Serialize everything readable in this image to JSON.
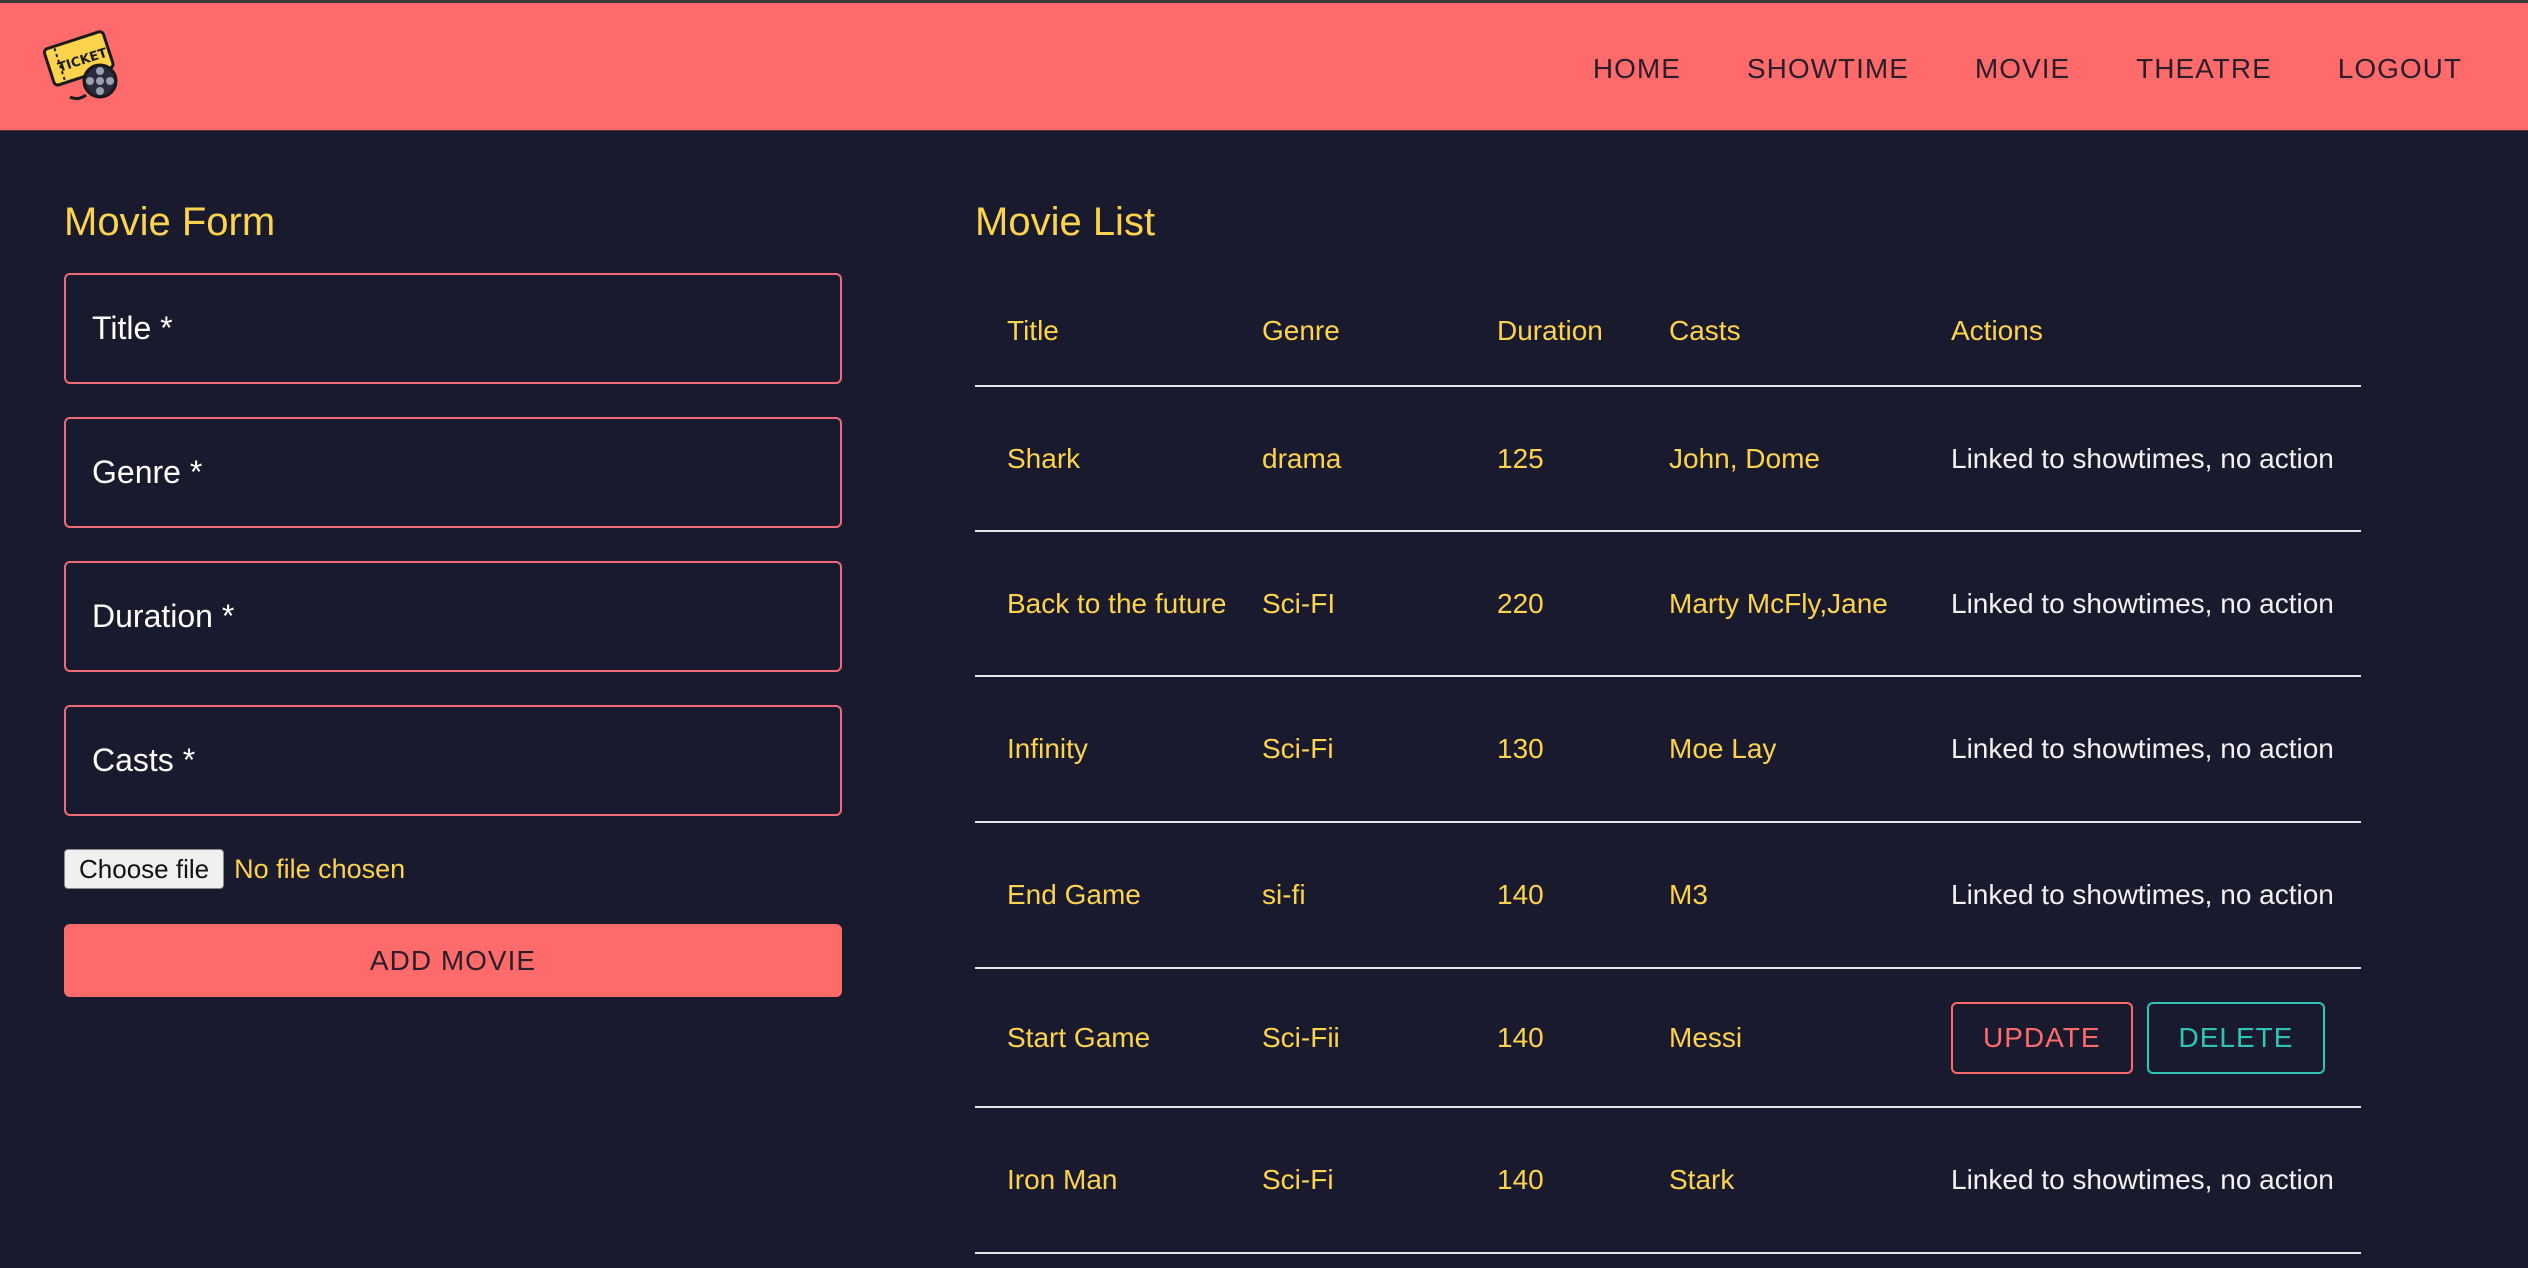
{
  "colors": {
    "brand": "#ff6b6b",
    "background": "#1a1a2e",
    "accent_text": "#fcd34d",
    "update": "#ff6b6b",
    "delete": "#2ec4b6"
  },
  "logo": {
    "icon": "ticket-film-reel-icon",
    "text": "TICKET"
  },
  "nav": {
    "home": "HOME",
    "showtime": "SHOWTIME",
    "movie": "MOVIE",
    "theatre": "THEATRE",
    "logout": "LOGOUT"
  },
  "form": {
    "title": "Movie Form",
    "fields": {
      "title": {
        "placeholder": "Title *",
        "value": ""
      },
      "genre": {
        "placeholder": "Genre *",
        "value": ""
      },
      "duration": {
        "placeholder": "Duration *",
        "value": ""
      },
      "casts": {
        "placeholder": "Casts *",
        "value": ""
      }
    },
    "file_button": "Choose file",
    "file_status": "No file chosen",
    "submit": "ADD MOVIE"
  },
  "list": {
    "title": "Movie List",
    "columns": [
      "Title",
      "Genre",
      "Duration",
      "Casts",
      "Actions"
    ],
    "rows": [
      {
        "title": "Shark",
        "genre": "drama",
        "duration": "125",
        "casts": "John, Dome",
        "action": "Linked to showtimes, no action"
      },
      {
        "title": "Back to the future",
        "genre": "Sci-FI",
        "duration": "220",
        "casts": "Marty McFly,Jane",
        "action": "Linked to showtimes, no action"
      },
      {
        "title": "Infinity",
        "genre": "Sci-Fi",
        "duration": "130",
        "casts": "Moe Lay",
        "action": "Linked to showtimes, no action"
      },
      {
        "title": "End Game",
        "genre": "si-fi",
        "duration": "140",
        "casts": "M3",
        "action": "Linked to showtimes, no action"
      },
      {
        "title": "Start Game",
        "genre": "Sci-Fii",
        "duration": "140",
        "casts": "Messi",
        "update": "UPDATE",
        "delete": "DELETE"
      },
      {
        "title": "Iron Man",
        "genre": "Sci-Fi",
        "duration": "140",
        "casts": "Stark",
        "action": "Linked to showtimes, no action"
      }
    ]
  }
}
